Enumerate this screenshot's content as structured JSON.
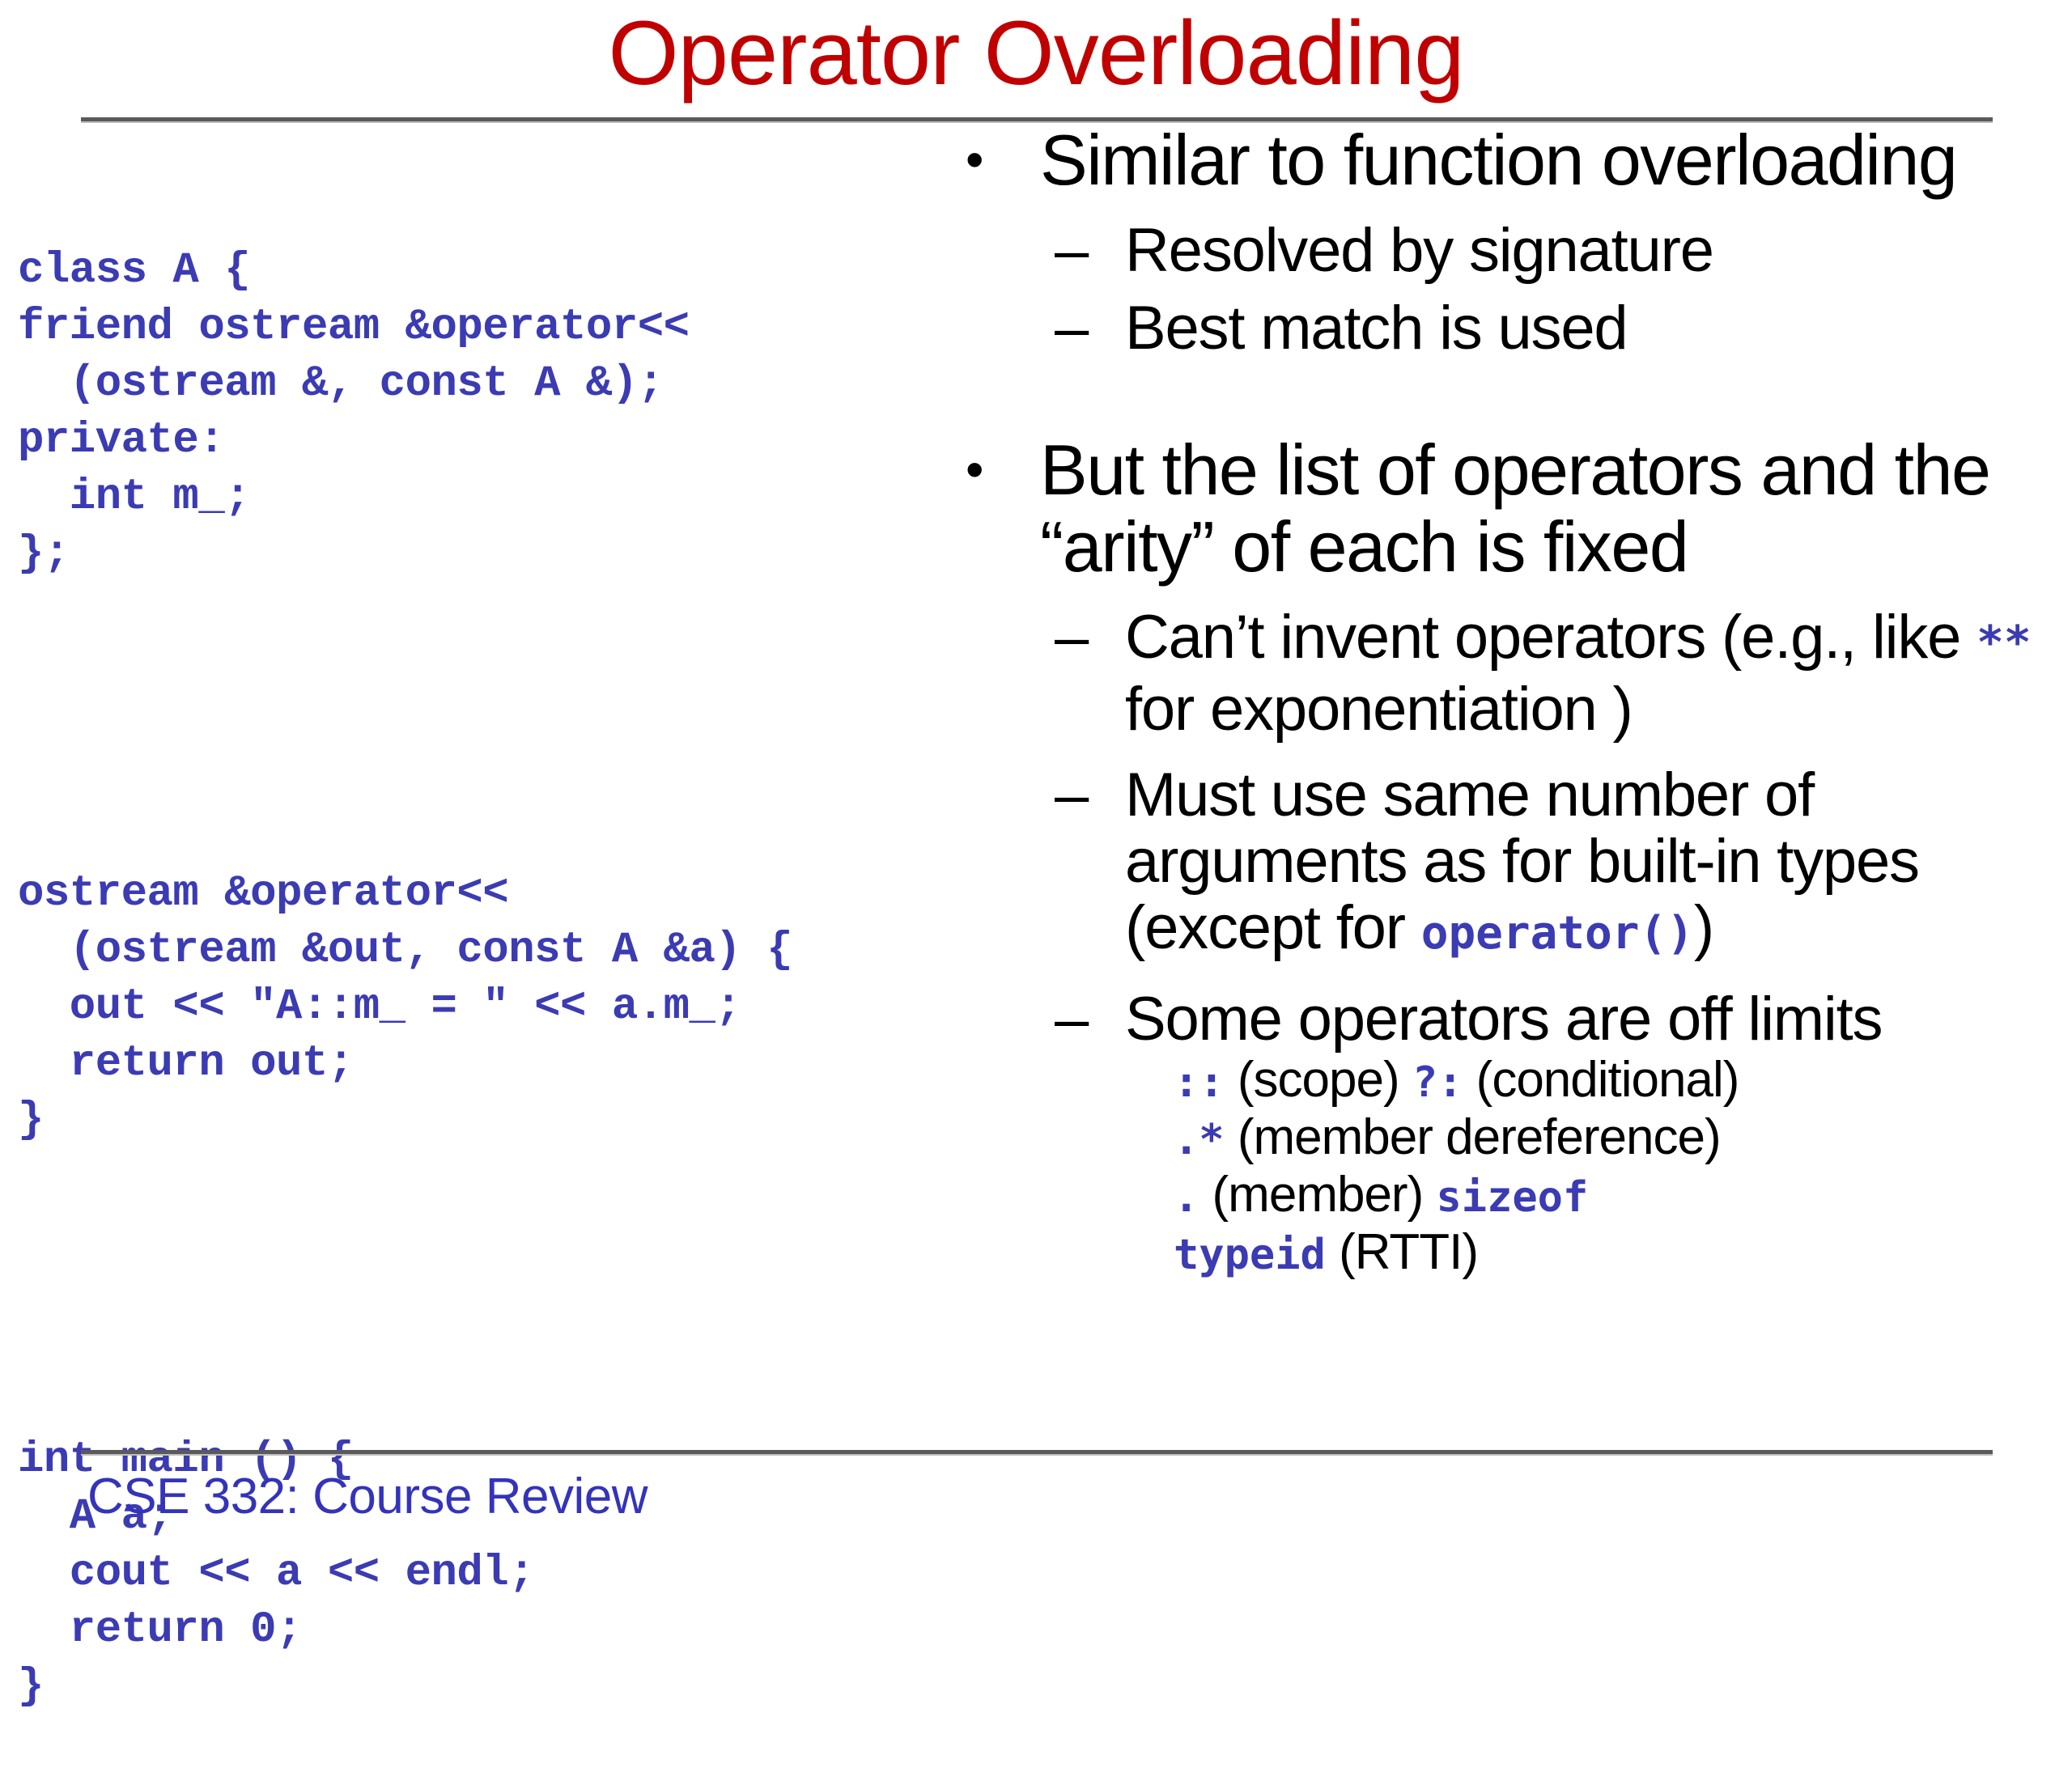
{
  "slide": {
    "title": "Operator Overloading",
    "title_color": "#c00000",
    "code_color": "#3b3bb3",
    "footer": "CSE 332: Course Review"
  },
  "code": {
    "block1": "class A {\nfriend ostream &operator<<\n  (ostream &, const A &);\nprivate:\n  int m_;\n};",
    "block2": "ostream &operator<<\n  (ostream &out, const A &a) {\n  out << \"A::m_ = \" << a.m_;\n  return out;\n}",
    "block3": "int main () {\n  A a;\n  cout << a << endl;\n  return 0;\n}"
  },
  "bullets": {
    "b1": {
      "marker": "•",
      "text": "Similar to function overloading",
      "sub": [
        {
          "marker": "–",
          "text": "Resolved by signature"
        },
        {
          "marker": "–",
          "text": "Best match is used"
        }
      ]
    },
    "b2": {
      "marker": "•",
      "text": "But the list of operators and the “arity” of each is fixed",
      "sub": [
        {
          "marker": "–",
          "pre": "Can’t invent operators (e.g., like ",
          "code": "**",
          "post": " for exponentiation )"
        },
        {
          "marker": "–",
          "pre": "Must use same number of arguments as for built-in types (except for ",
          "code": "operator()",
          "post": ")"
        },
        {
          "marker": "–",
          "text": "Some operators are off limits",
          "sub3": [
            {
              "code1": "::",
              "t1": " (scope) ",
              "code2": "?:",
              "t2": " (conditional)"
            },
            {
              "code1": ".*",
              "t1": " (member dereference)"
            },
            {
              "code1": ".",
              "t1": " (member) ",
              "code2": "sizeof"
            },
            {
              "code1": "typeid",
              "t1": " (RTTI)"
            }
          ]
        }
      ]
    }
  }
}
